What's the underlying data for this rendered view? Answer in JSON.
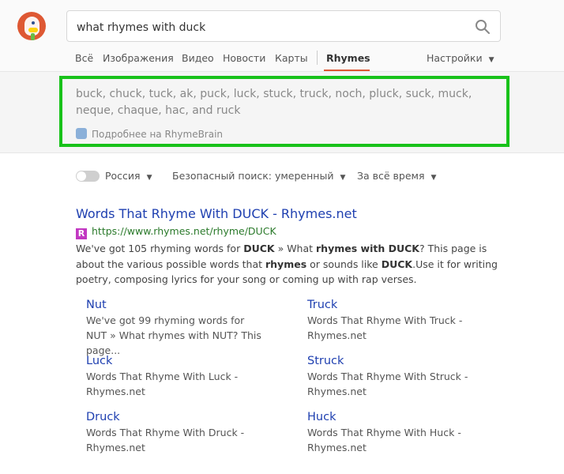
{
  "search": {
    "query": "what rhymes with duck"
  },
  "nav": {
    "tabs": [
      "Всё",
      "Изображения",
      "Видео",
      "Новости",
      "Карты",
      "Rhymes"
    ],
    "active": "Rhymes",
    "settings": "Настройки"
  },
  "instant_answer": {
    "rhymes": "buck, chuck, tuck, ak, puck, luck, stuck, truck, noch, pluck, suck, muck, neque, chaque, hac, and ruck",
    "more_link": "Подробнее на RhymeBrain"
  },
  "filters": {
    "region": "Россия",
    "safe_search": "Безопасный поиск: умеренный",
    "time": "За всё время"
  },
  "result": {
    "title": "Words That Rhyme With DUCK - Rhymes.net",
    "favicon_letter": "R",
    "url": "https://www.rhymes.net/rhyme/DUCK",
    "snippet": {
      "p1": "We've got 105 rhyming words for ",
      "b1": "DUCK",
      "p2": " » What ",
      "b2": "rhymes with DUCK",
      "p3": "? This page is about the various possible words that ",
      "b3": "rhymes",
      "p4": " or sounds like ",
      "b4": "DUCK",
      "p5": ".Use it for writing poetry, composing lyrics for your song or coming up with rap verses."
    },
    "sitelinks": [
      {
        "title": "Nut",
        "desc": "We've got 99 rhyming words for NUT » What rhymes with NUT? This page..."
      },
      {
        "title": "Truck",
        "desc": "Words That Rhyme With Truck - Rhymes.net"
      },
      {
        "title": "Luck",
        "desc": "Words That Rhyme With Luck - Rhymes.net"
      },
      {
        "title": "Struck",
        "desc": "Words That Rhyme With Struck - Rhymes.net"
      },
      {
        "title": "Druck",
        "desc": "Words That Rhyme With Druck - Rhymes.net"
      },
      {
        "title": "Huck",
        "desc": "Words That Rhyme With Huck - Rhymes.net"
      }
    ]
  },
  "colors": {
    "accent": "#de5833",
    "highlight": "#18c21a",
    "link": "#1e3fb0",
    "url": "#2b7a2b"
  }
}
